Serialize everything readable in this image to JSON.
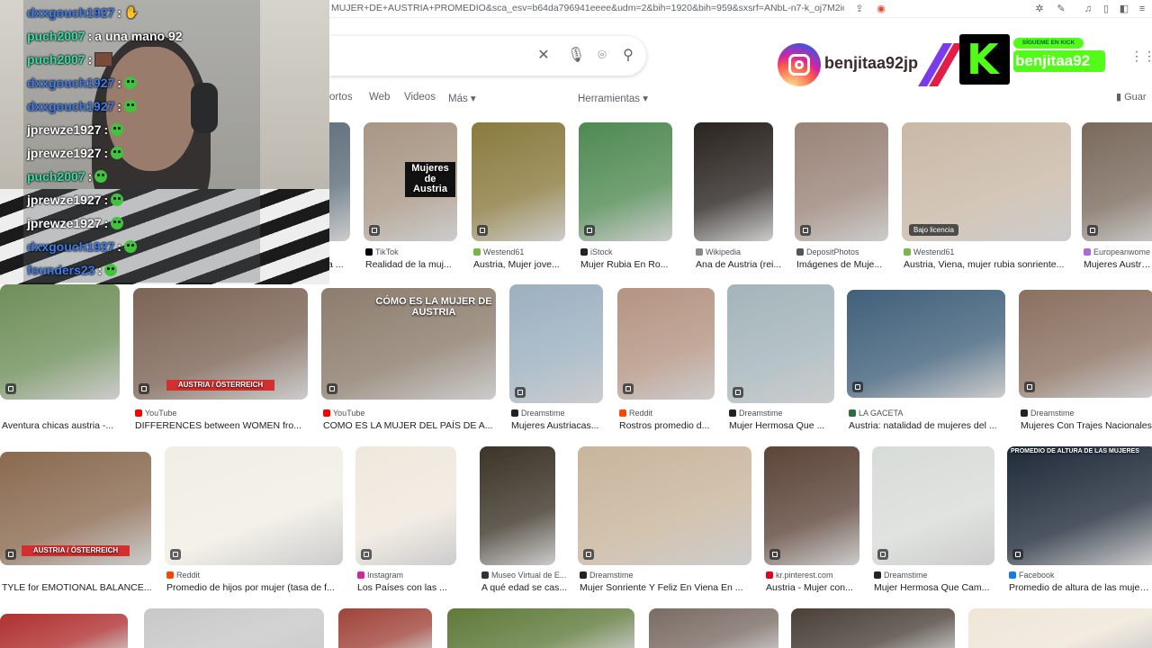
{
  "browser": {
    "url": "MUJER+DE+AUSTRIA+PROMEDIO&sca_esv=b64da796941eeee&udm=2&bih=1920&bih=959&sxsrf=ANbL-n7-k_oj7M2ioX..."
  },
  "search": {},
  "filters": [
    {
      "label": "ortos"
    },
    {
      "label": "Web"
    },
    {
      "label": "Videos"
    },
    {
      "label": "Más ▾"
    }
  ],
  "tools_label": "Herramientas ▾",
  "save_label": "Guar",
  "overlay": {
    "instagram_handle": "benjitaa92jp",
    "kick_tagline": "SÍGUEME EN KICK",
    "kick_handle": "benjitaa92"
  },
  "chat": [
    {
      "user": "dxxgouch1927",
      "message": "",
      "emote": "hand",
      "color": "#3d7cf0"
    },
    {
      "user": "puch2007",
      "message": "a una mano 92",
      "emote": "",
      "color": "#35e0a8"
    },
    {
      "user": "puch2007",
      "message": "",
      "emote": "box",
      "color": "#35e0a8"
    },
    {
      "user": "dxxgouch1927",
      "message": "",
      "emote": "frog",
      "color": "#3d7cf0"
    },
    {
      "user": "dxxgouch1927",
      "message": "",
      "emote": "frog",
      "color": "#3d7cf0"
    },
    {
      "user": "jprewze1927",
      "message": "",
      "emote": "frog",
      "color": "#ffffff"
    },
    {
      "user": "jprewze1927",
      "message": "",
      "emote": "frog",
      "color": "#ffffff"
    },
    {
      "user": "puch2007",
      "message": "",
      "emote": "frog",
      "color": "#35e0a8"
    },
    {
      "user": "jprewze1927",
      "message": "",
      "emote": "frog",
      "color": "#ffffff"
    },
    {
      "user": "jprewze1927",
      "message": "",
      "emote": "frog",
      "color": "#ffffff"
    },
    {
      "user": "dxxgouch1927",
      "message": "",
      "emote": "frog",
      "color": "#3d7cf0"
    },
    {
      "user": "founders23",
      "message": "",
      "emote": "frog",
      "color": "#3d7cf0"
    }
  ],
  "images": [
    {
      "source": "Wikipedia",
      "caption": "María Clementina ...",
      "overlay": "",
      "color": "#5a6b78",
      "fav": "#888888"
    },
    {
      "source": "TikTok",
      "caption": "Realidad de la muj...",
      "overlay": "Mujeres de Austria",
      "color": "#a89684",
      "fav": "#000000"
    },
    {
      "source": "Westend61",
      "caption": "Austria, Mujer jove...",
      "overlay": "",
      "color": "#8a7a3e",
      "fav": "#7bb34b"
    },
    {
      "source": "iStock",
      "caption": "Mujer Rubia En Ro...",
      "overlay": "",
      "color": "#4f8a52",
      "fav": "#222222"
    },
    {
      "source": "Wikipedia",
      "caption": "Ana de Austria (rei...",
      "overlay": "",
      "color": "#2a2420",
      "fav": "#888888"
    },
    {
      "source": "DepositPhotos",
      "caption": "Imágenes de Muje...",
      "overlay": "",
      "color": "#9a8478",
      "fav": "#555555"
    },
    {
      "source": "Westend61",
      "caption": "Austria, Viena, mujer rubia sonriente...",
      "overlay": "Bajo licencia",
      "color": "#c9b8a6",
      "fav": "#7bb34b"
    },
    {
      "source": "Europeanwome",
      "caption": "Mujeres Austriac",
      "overlay": "",
      "color": "#7a6a5c",
      "fav": "#b06ad0"
    },
    {
      "source": "",
      "caption": "Aventura chicas austria -...",
      "overlay": "",
      "color": "#6f8f5a",
      "fav": "#ffffff"
    },
    {
      "source": "YouTube",
      "caption": "DIFFERENCES between WOMEN fro...",
      "overlay": "AUSTRIA / ÖSTERREICH",
      "color": "#7c6455",
      "fav": "#ff0000"
    },
    {
      "source": "YouTube",
      "caption": "COMO ES LA MUJER DEL PAÍS DE A...",
      "overlay": "CÓMO ES LA MUJER DE AUSTRIA",
      "color": "#8c7c6c",
      "fav": "#ff0000"
    },
    {
      "source": "Dreamstime",
      "caption": "Mujeres Austriacas...",
      "overlay": "",
      "color": "#9cb0c0",
      "fav": "#222222"
    },
    {
      "source": "Reddit",
      "caption": "Rostros promedio d...",
      "overlay": "",
      "color": "#b49482",
      "fav": "#ff4500"
    },
    {
      "source": "Dreamstime",
      "caption": "Mujer Hermosa Que ...",
      "overlay": "",
      "color": "#a3b4ba",
      "fav": "#222222"
    },
    {
      "source": "LA GACETA",
      "caption": "Austria: natalidad de mujeres del ...",
      "overlay": "",
      "color": "#40607a",
      "fav": "#2b6f3a"
    },
    {
      "source": "Dreamstime",
      "caption": "Mujeres Con Trajes Nacionales",
      "overlay": "",
      "color": "#8a7060",
      "fav": "#222222"
    },
    {
      "source": "",
      "caption": "TYLE for EMOTIONAL BALANCE...",
      "overlay": "AUSTRIA / ÖSTERREICH",
      "color": "#8a6a50",
      "fav": "#ffffff"
    },
    {
      "source": "Reddit",
      "caption": "Promedio de hijos por mujer (tasa de f...",
      "overlay": "",
      "color": "#f1eee4",
      "fav": "#ff4500"
    },
    {
      "source": "Instagram",
      "caption": "Los Países con las ...",
      "overlay": "",
      "color": "#efe8dd",
      "fav": "#d6249f"
    },
    {
      "source": "Museo Virtual de E...",
      "caption": "A qué edad se cas...",
      "overlay": "",
      "color": "#3c3428",
      "fav": "#333333"
    },
    {
      "source": "Dreamstime",
      "caption": "Mujer Sonriente Y Feliz En Viena En ...",
      "overlay": "",
      "color": "#c8b59c",
      "fav": "#222222"
    },
    {
      "source": "kr.pinterest.com",
      "caption": "Austria - Mujer con...",
      "overlay": "",
      "color": "#5c4438",
      "fav": "#e60023"
    },
    {
      "source": "Dreamstime",
      "caption": "Mujer Hermosa Que Cam...",
      "overlay": "",
      "color": "#d8dcd8",
      "fav": "#222222"
    },
    {
      "source": "Facebook",
      "caption": "Promedio de altura de las mujeres",
      "overlay": "PROMEDIO DE ALTURA DE LAS MUJERES",
      "color": "#202b3a",
      "fav": "#1877f2"
    },
    {
      "source": "",
      "caption": "",
      "overlay": "",
      "color": "#b03030",
      "fav": "#ffffff"
    },
    {
      "source": "",
      "caption": "",
      "overlay": "",
      "color": "#c8c8c8",
      "fav": "#ffffff"
    },
    {
      "source": "",
      "caption": "",
      "overlay": "",
      "color": "#a0443a",
      "fav": "#ffffff"
    },
    {
      "source": "",
      "caption": "",
      "overlay": "",
      "color": "#5f7a3a",
      "fav": "#ffffff"
    },
    {
      "source": "",
      "caption": "",
      "overlay": "",
      "color": "#7a6c64",
      "fav": "#ffffff"
    },
    {
      "source": "",
      "caption": "",
      "overlay": "",
      "color": "#4a4038",
      "fav": "#ffffff"
    },
    {
      "source": "",
      "caption": "",
      "overlay": "",
      "color": "#efe6d8",
      "fav": "#ffffff"
    }
  ]
}
